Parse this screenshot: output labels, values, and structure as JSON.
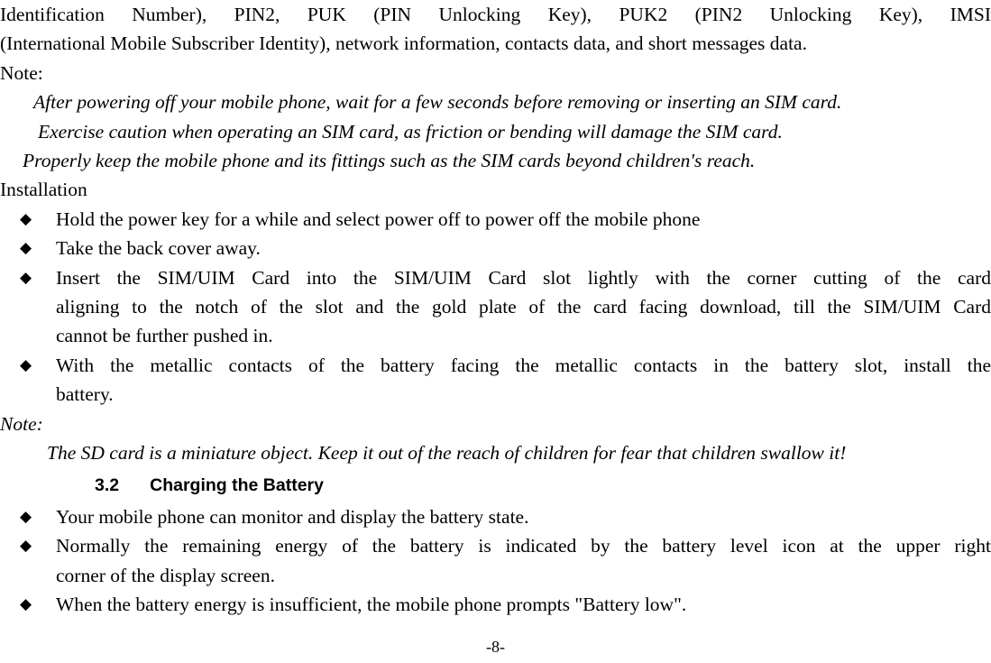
{
  "document": {
    "page_number_label": "-8-",
    "bullet_glyph": "◆",
    "text_color": "#000000",
    "background_color": "#ffffff"
  },
  "body": {
    "paragraph_continuation": {
      "line1": "Identification Number), PIN2, PUK (PIN Unlocking Key), PUK2 (PIN2 Unlocking Key), IMSI",
      "line2": "(International Mobile Subscriber Identity), network information, contacts data, and short messages data."
    },
    "note_one": {
      "label": "Note:",
      "lines": [
        "After powering off your mobile phone, wait for a few seconds before removing or inserting an SIM card.",
        "Exercise caution when operating an SIM card, as friction or bending will damage the SIM card.",
        "Properly keep the mobile phone and its fittings such as the SIM cards beyond children's reach."
      ]
    },
    "installation": {
      "label": "Installation",
      "items": [
        {
          "lines": [
            "Hold the power key for a while and select power off to power off the mobile phone"
          ]
        },
        {
          "lines": [
            "Take the back cover away."
          ]
        },
        {
          "lines": [
            "Insert the SIM/UIM Card into the SIM/UIM Card slot lightly with the corner cutting of the card",
            "aligning to the notch of the slot and the gold plate of the card facing download, till the SIM/UIM Card",
            "cannot be further pushed in."
          ]
        },
        {
          "lines": [
            "With the metallic contacts of the battery facing the metallic contacts in the battery slot, install the",
            "battery."
          ]
        }
      ]
    },
    "note_two": {
      "label": "Note:",
      "lines": [
        "The SD card is a miniature object. Keep it out of the reach of children for fear that children swallow it!"
      ]
    },
    "section_heading": {
      "number": "3.2",
      "title": "Charging the Battery"
    },
    "battery_items": [
      {
        "lines": [
          "Your mobile phone can monitor and display the battery state."
        ]
      },
      {
        "lines": [
          "Normally the remaining energy of the battery is indicated by the battery level icon at the upper right",
          "corner of the display screen."
        ]
      },
      {
        "lines": [
          "When the battery energy is insufficient, the mobile phone prompts \"Battery low\"."
        ]
      }
    ]
  }
}
